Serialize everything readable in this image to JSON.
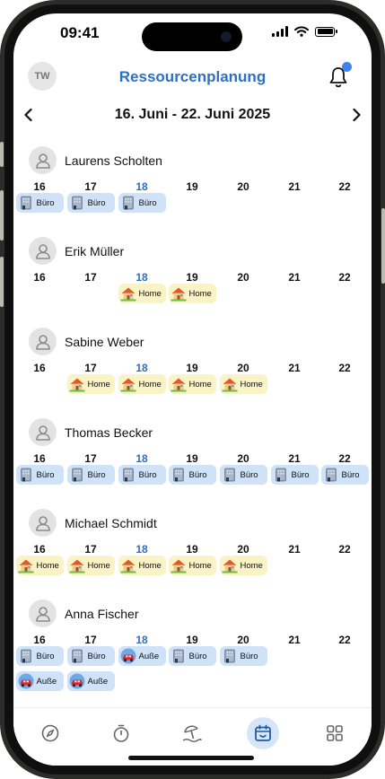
{
  "status_bar": {
    "time": "09:41"
  },
  "header": {
    "avatar_initials": "TW",
    "title": "Ressourcenplanung"
  },
  "week": {
    "label": "16. Juni - 22. Juni 2025",
    "days": [
      "16",
      "17",
      "18",
      "19",
      "20",
      "21",
      "22"
    ],
    "today_index": 2
  },
  "colors": {
    "accent": "#2e6fbf",
    "office_chip": "#cfe2f7",
    "home_chip": "#faf3c6",
    "notification_dot": "#3b82f6"
  },
  "people": [
    {
      "name": "Laurens Scholten",
      "entries": [
        {
          "day": 0,
          "type": "office",
          "label": "Büro"
        },
        {
          "day": 1,
          "type": "office",
          "label": "Büro"
        },
        {
          "day": 2,
          "type": "office",
          "label": "Büro"
        }
      ]
    },
    {
      "name": "Erik Müller",
      "entries": [
        {
          "day": 2,
          "type": "home",
          "label": "Home"
        },
        {
          "day": 3,
          "type": "home",
          "label": "Home"
        }
      ]
    },
    {
      "name": "Sabine Weber",
      "entries": [
        {
          "day": 1,
          "type": "home",
          "label": "Home"
        },
        {
          "day": 2,
          "type": "home",
          "label": "Home"
        },
        {
          "day": 3,
          "type": "home",
          "label": "Home"
        },
        {
          "day": 4,
          "type": "home",
          "label": "Home"
        }
      ]
    },
    {
      "name": "Thomas Becker",
      "entries": [
        {
          "day": 0,
          "type": "office",
          "label": "Büro"
        },
        {
          "day": 1,
          "type": "office",
          "label": "Büro"
        },
        {
          "day": 2,
          "type": "office",
          "label": "Büro"
        },
        {
          "day": 3,
          "type": "office",
          "label": "Büro"
        },
        {
          "day": 4,
          "type": "office",
          "label": "Büro"
        },
        {
          "day": 5,
          "type": "office",
          "label": "Büro"
        },
        {
          "day": 6,
          "type": "office",
          "label": "Büro"
        }
      ]
    },
    {
      "name": "Michael Schmidt",
      "entries": [
        {
          "day": 0,
          "type": "home",
          "label": "Home"
        },
        {
          "day": 1,
          "type": "home",
          "label": "Home"
        },
        {
          "day": 2,
          "type": "home",
          "label": "Home"
        },
        {
          "day": 3,
          "type": "home",
          "label": "Home"
        },
        {
          "day": 4,
          "type": "home",
          "label": "Home"
        }
      ]
    },
    {
      "name": "Anna Fischer",
      "entries": [
        {
          "day": 0,
          "type": "office",
          "label": "Büro"
        },
        {
          "day": 1,
          "type": "office",
          "label": "Büro"
        },
        {
          "day": 2,
          "type": "away",
          "label": "Auße"
        },
        {
          "day": 3,
          "type": "office",
          "label": "Büro"
        },
        {
          "day": 4,
          "type": "office",
          "label": "Büro"
        },
        {
          "day": 0,
          "type": "away",
          "label": "Auße",
          "row": 2
        },
        {
          "day": 1,
          "type": "away",
          "label": "Auße",
          "row": 2
        }
      ]
    }
  ],
  "tabs": [
    {
      "icon": "compass-icon",
      "active": false
    },
    {
      "icon": "stopwatch-icon",
      "active": false
    },
    {
      "icon": "beach-icon",
      "active": false
    },
    {
      "icon": "calendar-icon",
      "active": true
    },
    {
      "icon": "grid-icon",
      "active": false
    }
  ]
}
